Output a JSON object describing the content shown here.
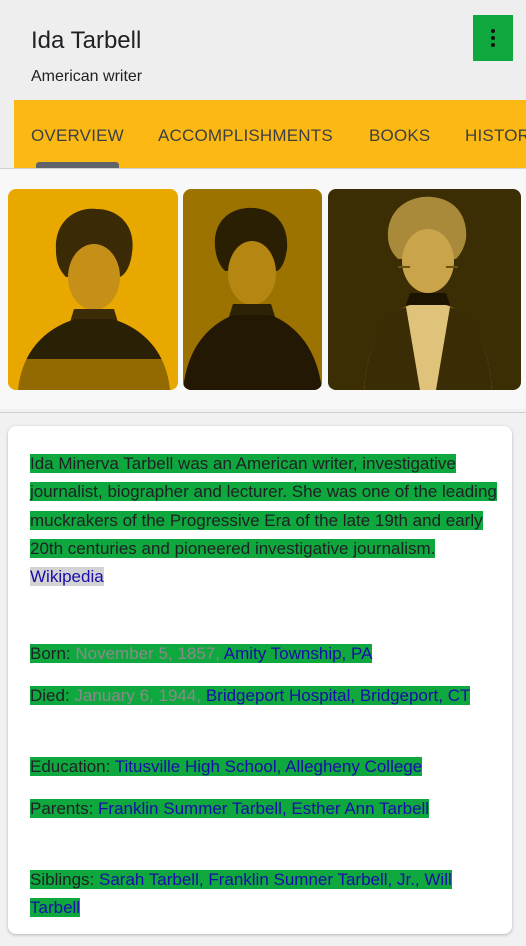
{
  "header": {
    "title": "Ida Tarbell",
    "subtitle": "American writer"
  },
  "tabs": [
    {
      "label": "OVERVIEW"
    },
    {
      "label": "ACCOMPLISHMENTS"
    },
    {
      "label": "BOOKS"
    },
    {
      "label": "HISTORY"
    }
  ],
  "images": [
    {
      "name": "ida-tarbell-portrait-1",
      "tint": "#e9a800"
    },
    {
      "name": "ida-tarbell-portrait-2",
      "tint": "#9c7300"
    },
    {
      "name": "ida-tarbell-portrait-3",
      "tint": "#6b5200"
    }
  ],
  "description": {
    "text": "Ida Minerva Tarbell was an American writer, investigative journalist, biographer and lecturer. She was one of the leading muckrakers of the Progressive Era of the late 19th and early 20th centuries and pioneered investigative journalism.",
    "source": "Wikipedia"
  },
  "facts": {
    "born": {
      "label": "Born:",
      "date": "November 5, 1857,",
      "place": "Amity Township, PA"
    },
    "died": {
      "label": "Died:",
      "date": "January 6, 1944,",
      "place": "Bridgeport Hospital, Bridgeport, CT"
    },
    "education": {
      "label": "Education:",
      "first": "Titusville High School,",
      "second": "Allegheny College"
    },
    "parents": {
      "label": "Parents:",
      "first": "Franklin Summer Tarbell,",
      "second": "Esther Ann Tarbell"
    },
    "siblings": {
      "label": "Siblings:",
      "first": "Sarah Tarbell,",
      "second": "Franklin Sumner Tarbell, Jr.,",
      "third": "Will Tarbell"
    }
  },
  "colors": {
    "accent_tab": "#fdb913",
    "highlight": "#0fa83f",
    "link": "#1a0dab"
  }
}
